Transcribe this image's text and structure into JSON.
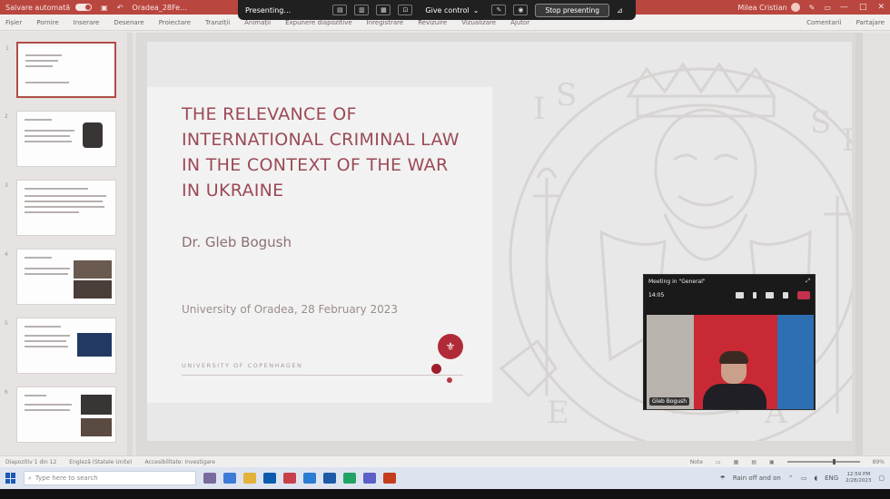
{
  "titlebar": {
    "autosave": "Salvare automată",
    "filename": "Oradea_28Fe…",
    "user": "Milea Cristian"
  },
  "presenter_bar": {
    "presenting": "Presenting…",
    "give_control": "Give control",
    "stop": "Stop presenting"
  },
  "ribbon": {
    "tabs": [
      "Fișier",
      "Pornire",
      "Inserare",
      "Desenare",
      "Proiectare",
      "Tranziții",
      "Animații",
      "Expunere diapozitive",
      "Înregistrare",
      "Revizuire",
      "Vizualizare",
      "Ajutor"
    ],
    "right": [
      "Comentarii",
      "Partajare"
    ]
  },
  "thumbnails": [
    "1",
    "2",
    "3",
    "4",
    "5",
    "6"
  ],
  "slide": {
    "title": "THE RELEVANCE OF INTERNATIONAL CRIMINAL LAW IN THE CONTEXT OF THE WAR IN UKRAINE",
    "presenter": "Dr. Gleb Bogush",
    "venue": "University of Oradea, 28 February 2023",
    "university_line": "UNIVERSITY OF COPENHAGEN"
  },
  "call": {
    "title": "Meeting in \"General\"",
    "timer": "14:05",
    "participant": "Gleb Bogush"
  },
  "statusbar": {
    "slide_info": "Diapozitiv 1 din 12",
    "language": "Engleză (Statele Unite)",
    "accessibility": "Accesibilitate: Investigare",
    "notes": "Note",
    "zoom": "89%"
  },
  "taskbar": {
    "search_placeholder": "Type here to search",
    "weather": "Rain off and on",
    "time": "12:59 PM",
    "date": "2/28/2023",
    "language": "ENG"
  },
  "colors": {
    "accent": "#b9473f",
    "slide_title": "#9a4a56",
    "leave": "#c4314b"
  }
}
